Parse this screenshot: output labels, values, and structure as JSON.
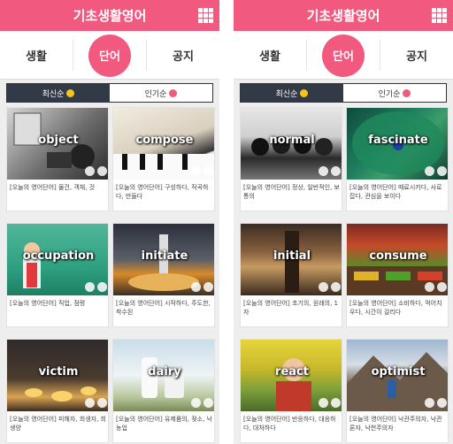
{
  "panels": [
    {
      "title": "기초생활영어",
      "tabs": [
        "생활",
        "단어",
        "공지"
      ],
      "active_tab": 1,
      "sort": {
        "latest": "최신순",
        "popular": "인기순"
      },
      "cards": [
        {
          "word": "object",
          "caption": "[오늘의 영어단어] 물건, 객체, 것"
        },
        {
          "word": "compose",
          "caption": "[오늘의 영어단어] 구성하다, 작곡하다, 만들다"
        },
        {
          "word": "occupation",
          "caption": "[오늘의 영어단어] 직업, 점령"
        },
        {
          "word": "initiate",
          "caption": "[오늘의 영어단어] 시작하다, 주도한, 착수된"
        },
        {
          "word": "victim",
          "caption": "[오늘의 영어단어] 피해자, 희생자, 희생양"
        },
        {
          "word": "dairy",
          "caption": "[오늘의 영어단어] 유제품의, 젖소, 낙농업"
        }
      ]
    },
    {
      "title": "기초생활영어",
      "tabs": [
        "생활",
        "단어",
        "공지"
      ],
      "active_tab": 1,
      "sort": {
        "latest": "최신순",
        "popular": "인기순"
      },
      "cards": [
        {
          "word": "normal",
          "caption": "[오늘의 영어단어] 정상, 일반적인, 보통의"
        },
        {
          "word": "fascinate",
          "caption": "[오늘의 영어단어] 매료시키다, 사로잡다, 관심을 보이다"
        },
        {
          "word": "initial",
          "caption": "[오늘의 영어단어] 초기의, 원래의, 1자"
        },
        {
          "word": "consume",
          "caption": "[오늘의 영어단어] 소비하다, 먹어치우다, 시간이 걸리다"
        },
        {
          "word": "react",
          "caption": "[오늘의 영어단어] 반응하다, 대응하다, 대처하다"
        },
        {
          "word": "optimist",
          "caption": "[오늘의 영어단어] 낙관주의자, 낙관론자, 낙천주의자"
        }
      ]
    }
  ],
  "colors": {
    "accent": "#f2597f",
    "sort_active": "#333a47",
    "dot_latest": "#f5c518",
    "dot_popular": "#f2597f"
  },
  "icons": {
    "menu": "grid-menu-icon",
    "card_actions": [
      "like-icon",
      "share-icon"
    ]
  }
}
